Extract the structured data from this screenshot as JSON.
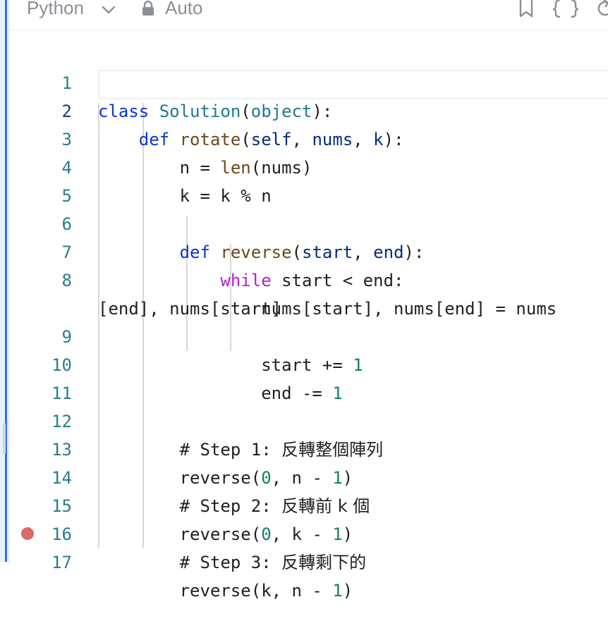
{
  "toolbar": {
    "language": "Python",
    "mode_label": "Auto",
    "icons": [
      "chevron-down-icon",
      "lock-icon",
      "bookmark-icon",
      "braces-icon",
      "reset-icon"
    ]
  },
  "editor": {
    "active_line": 2,
    "breakpoint_line": 17,
    "line_numbers": [
      "1",
      "2",
      "3",
      "4",
      "5",
      "6",
      "7",
      "8",
      "9",
      "10",
      "11",
      "12",
      "13",
      "14",
      "15",
      "16",
      "17"
    ],
    "code": {
      "l1": {
        "kw": "class",
        "name": "Solution",
        "p1": "(",
        "base": "object",
        "p2": "):"
      },
      "l2": {
        "kw": "def",
        "name": "rotate",
        "p1": "(",
        "a1": "self",
        ",1": ", ",
        "a2": "nums",
        ",2": ", ",
        "a3": "k",
        "p2": "):"
      },
      "l3": {
        "pre": "n = ",
        "fn": "len",
        "rest": "(nums)"
      },
      "l4": {
        "text": "k = k % n"
      },
      "l6": {
        "kw": "def",
        "name": "reverse",
        "p1": "(",
        "a1": "start",
        ",1": ", ",
        "a2": "end",
        "p2": "):"
      },
      "l7": {
        "kw": "while",
        "rest": " start < end:"
      },
      "l8": {
        "text": "nums[start], nums[end] = nums"
      },
      "l8b": {
        "text": "[end], nums[start]"
      },
      "l9": {
        "pre": "start += ",
        "num": "1"
      },
      "l10": {
        "pre": "end -= ",
        "num": "1"
      },
      "l12": {
        "text": "# Step 1: ",
        "cjk": "反轉整個陣列"
      },
      "l13": {
        "pre": "reverse(",
        "n0": "0",
        "mid": ", n - ",
        "n1": "1",
        "post": ")"
      },
      "l14": {
        "text": "# Step 2: ",
        "cjk": "反轉前 k 個"
      },
      "l15": {
        "pre": "reverse(",
        "n0": "0",
        "mid": ", k - ",
        "n1": "1",
        "post": ")"
      },
      "l16": {
        "text": "# Step 3: ",
        "cjk": "反轉剩下的"
      },
      "l17": {
        "pre": "reverse(k, n - ",
        "n1": "1",
        "post": ")"
      }
    }
  }
}
